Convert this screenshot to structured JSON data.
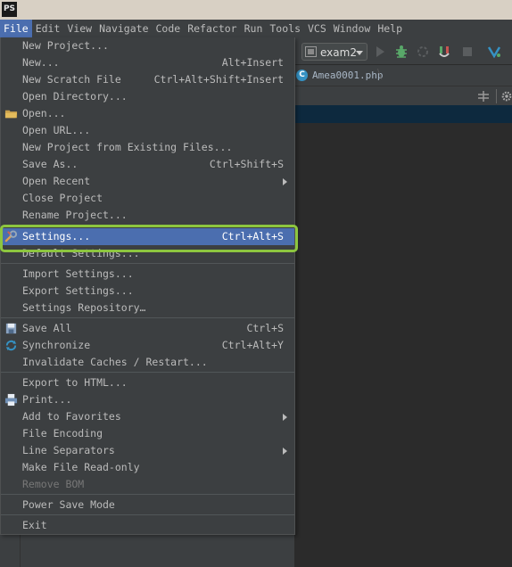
{
  "app": {
    "logo": "PS"
  },
  "menubar": {
    "items": [
      "File",
      "Edit",
      "View",
      "Navigate",
      "Code",
      "Refactor",
      "Run",
      "Tools",
      "VCS",
      "Window",
      "Help"
    ]
  },
  "toolbar": {
    "run_config": "exam2"
  },
  "editor": {
    "active_file": "Amea0001.php",
    "file_icon_letter": "C"
  },
  "file_menu": {
    "items": [
      {
        "label": "New Project...",
        "shortcut": ""
      },
      {
        "label": "New...",
        "shortcut": "Alt+Insert"
      },
      {
        "label": "New Scratch File",
        "shortcut": "Ctrl+Alt+Shift+Insert"
      },
      {
        "label": "Open Directory...",
        "shortcut": ""
      },
      {
        "label": "Open...",
        "shortcut": "",
        "icon": "folder-icon"
      },
      {
        "label": "Open URL...",
        "shortcut": ""
      },
      {
        "label": "New Project from Existing Files...",
        "shortcut": ""
      },
      {
        "label": "Save As..",
        "shortcut": "Ctrl+Shift+S"
      },
      {
        "label": "Open Recent",
        "shortcut": "",
        "submenu": true
      },
      {
        "label": "Close Project",
        "shortcut": ""
      },
      {
        "label": "Rename Project...",
        "shortcut": ""
      },
      {
        "label": "Settings...",
        "shortcut": "Ctrl+Alt+S",
        "icon": "wrench-icon",
        "highlighted": true
      },
      {
        "label": "Default Settings...",
        "shortcut": ""
      },
      {
        "label": "Import Settings...",
        "shortcut": ""
      },
      {
        "label": "Export Settings...",
        "shortcut": ""
      },
      {
        "label": "Settings Repository…",
        "shortcut": ""
      },
      {
        "label": "Save All",
        "shortcut": "Ctrl+S",
        "icon": "save-icon"
      },
      {
        "label": "Synchronize",
        "shortcut": "Ctrl+Alt+Y",
        "icon": "sync-icon"
      },
      {
        "label": "Invalidate Caches / Restart...",
        "shortcut": ""
      },
      {
        "label": "Export to HTML...",
        "shortcut": ""
      },
      {
        "label": "Print...",
        "shortcut": "",
        "icon": "printer-icon"
      },
      {
        "label": "Add to Favorites",
        "shortcut": "",
        "submenu": true
      },
      {
        "label": "File Encoding",
        "shortcut": ""
      },
      {
        "label": "Line Separators",
        "shortcut": "",
        "submenu": true
      },
      {
        "label": "Make File Read-only",
        "shortcut": ""
      },
      {
        "label": "Remove BOM",
        "shortcut": "",
        "disabled": true
      },
      {
        "label": "Power Save Mode",
        "shortcut": ""
      },
      {
        "label": "Exit",
        "shortcut": ""
      }
    ]
  },
  "colors": {
    "highlight": "#4b6eaf",
    "callout": "#8dc63f",
    "menu_bg": "#3c3f41",
    "editor_bg": "#2b2b2b"
  }
}
